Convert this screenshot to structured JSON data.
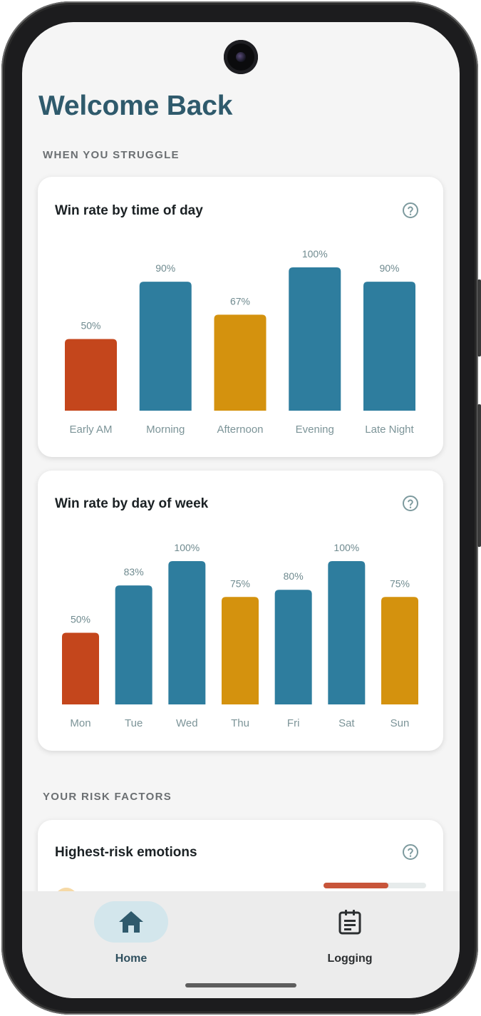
{
  "page": {
    "title": "Welcome Back"
  },
  "sections": {
    "struggle_label": "WHEN YOU STRUGGLE",
    "risk_label": "YOUR RISK FACTORS"
  },
  "colors": {
    "good": "#2e7d9e",
    "mid": "#d4920e",
    "low": "#c4461c",
    "title": "#2f5a6c"
  },
  "cards": {
    "time_of_day": {
      "title": "Win rate by time of day"
    },
    "day_of_week": {
      "title": "Win rate by day of week"
    },
    "emotions": {
      "title": "Highest-risk emotions",
      "top_fill": 0.63
    }
  },
  "chart_data": [
    {
      "type": "bar",
      "title": "Win rate by time of day",
      "categories": [
        "Early AM",
        "Morning",
        "Afternoon",
        "Evening",
        "Late Night"
      ],
      "values": [
        50,
        90,
        67,
        100,
        90
      ],
      "value_labels": [
        "50%",
        "90%",
        "67%",
        "100%",
        "90%"
      ],
      "bar_colors": [
        "#c4461c",
        "#2e7d9e",
        "#d4920e",
        "#2e7d9e",
        "#2e7d9e"
      ],
      "ylim": [
        0,
        100
      ],
      "grid": false
    },
    {
      "type": "bar",
      "title": "Win rate by day of week",
      "categories": [
        "Mon",
        "Tue",
        "Wed",
        "Thu",
        "Fri",
        "Sat",
        "Sun"
      ],
      "values": [
        50,
        83,
        100,
        75,
        80,
        100,
        75
      ],
      "value_labels": [
        "50%",
        "83%",
        "100%",
        "75%",
        "80%",
        "100%",
        "75%"
      ],
      "bar_colors": [
        "#c4461c",
        "#2e7d9e",
        "#2e7d9e",
        "#d4920e",
        "#2e7d9e",
        "#2e7d9e",
        "#d4920e"
      ],
      "ylim": [
        0,
        100
      ],
      "grid": false
    }
  ],
  "nav": {
    "items": [
      {
        "label": "Home",
        "icon": "home-icon",
        "active": true
      },
      {
        "label": "Logging",
        "icon": "clipboard-icon",
        "active": false
      }
    ]
  }
}
